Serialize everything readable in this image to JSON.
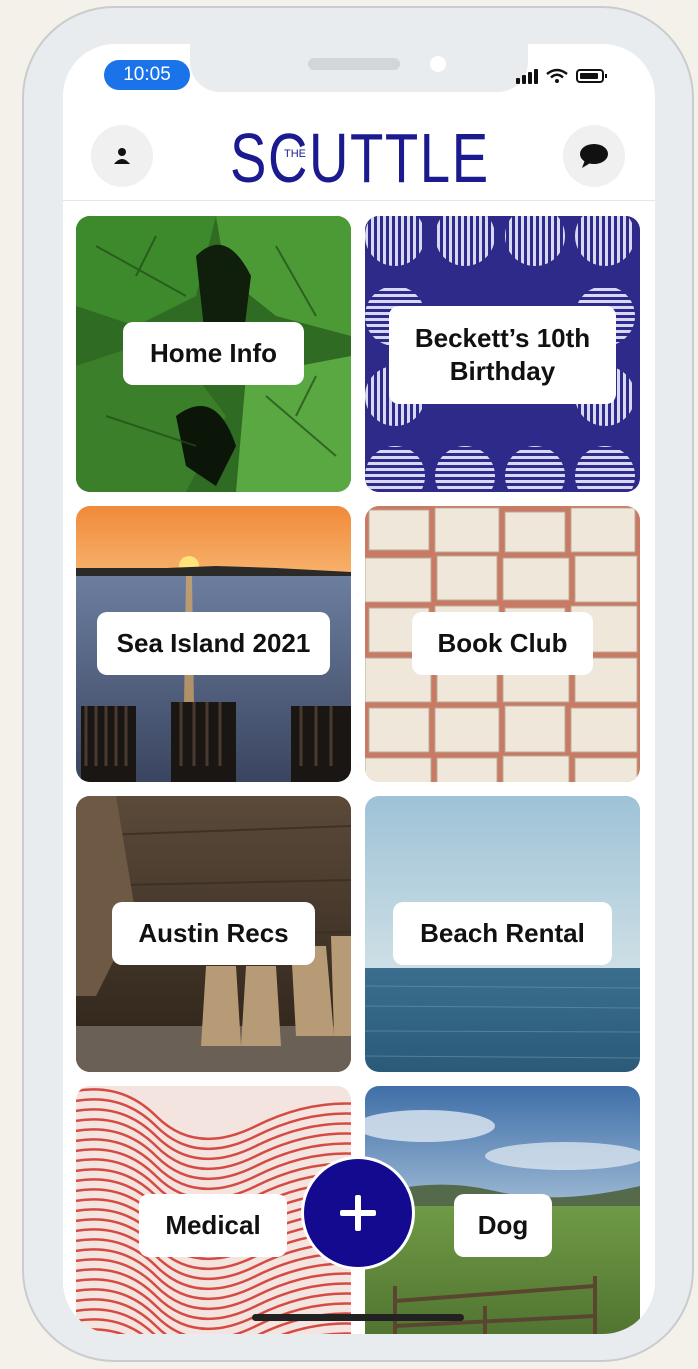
{
  "status_bar": {
    "time": "10:05"
  },
  "header": {
    "logo_main": "SCUTTLE",
    "logo_small": "THE",
    "profile_icon": "person-icon",
    "messages_icon": "chat-bubble-icon"
  },
  "tiles": [
    {
      "label": "Home Info"
    },
    {
      "label": "Beckett’s 10th Birthday"
    },
    {
      "label": "Sea Island 2021"
    },
    {
      "label": "Book Club"
    },
    {
      "label": "Austin Recs"
    },
    {
      "label": "Beach Rental"
    },
    {
      "label": "Medical"
    },
    {
      "label": "Dog"
    }
  ],
  "fab": {
    "icon": "plus-icon"
  },
  "colors": {
    "brand": "#1b1b8f",
    "fab": "#130a8f",
    "time_pill": "#1a73e8"
  }
}
